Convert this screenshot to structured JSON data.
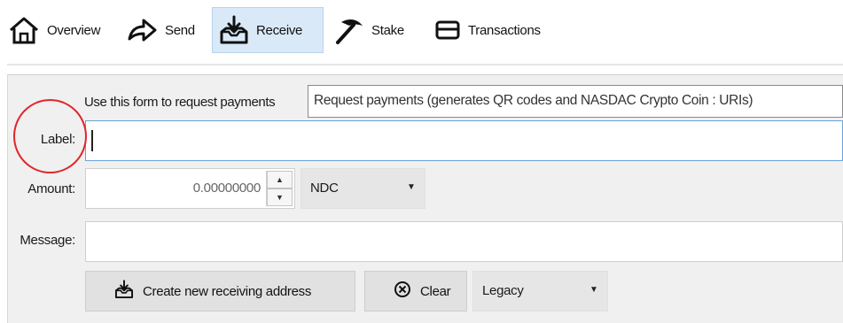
{
  "toolbar": {
    "items": [
      {
        "label": "Overview",
        "icon": "home-icon"
      },
      {
        "label": "Send",
        "icon": "send-arrow-icon"
      },
      {
        "label": "Receive",
        "icon": "receive-inbox-icon",
        "active": true
      },
      {
        "label": "Stake",
        "icon": "pickaxe-icon"
      },
      {
        "label": "Transactions",
        "icon": "transactions-card-icon"
      }
    ]
  },
  "form": {
    "intro_text": "Use this form to request payments",
    "tooltip": "Request payments (generates QR codes and NASDAC Crypto Coin : URIs)",
    "label_label": "Label:",
    "label_value": "",
    "amount_label": "Amount:",
    "amount_value": "0.00000000",
    "unit": "NDC",
    "message_label": "Message:",
    "message_value": ""
  },
  "actions": {
    "create_label": "Create new receiving address",
    "clear_label": "Clear",
    "address_type": "Legacy"
  },
  "colors": {
    "active_tab_bg": "#d9e9f8",
    "panel_bg": "#f0f0f0",
    "highlight_circle": "#e0262b"
  }
}
